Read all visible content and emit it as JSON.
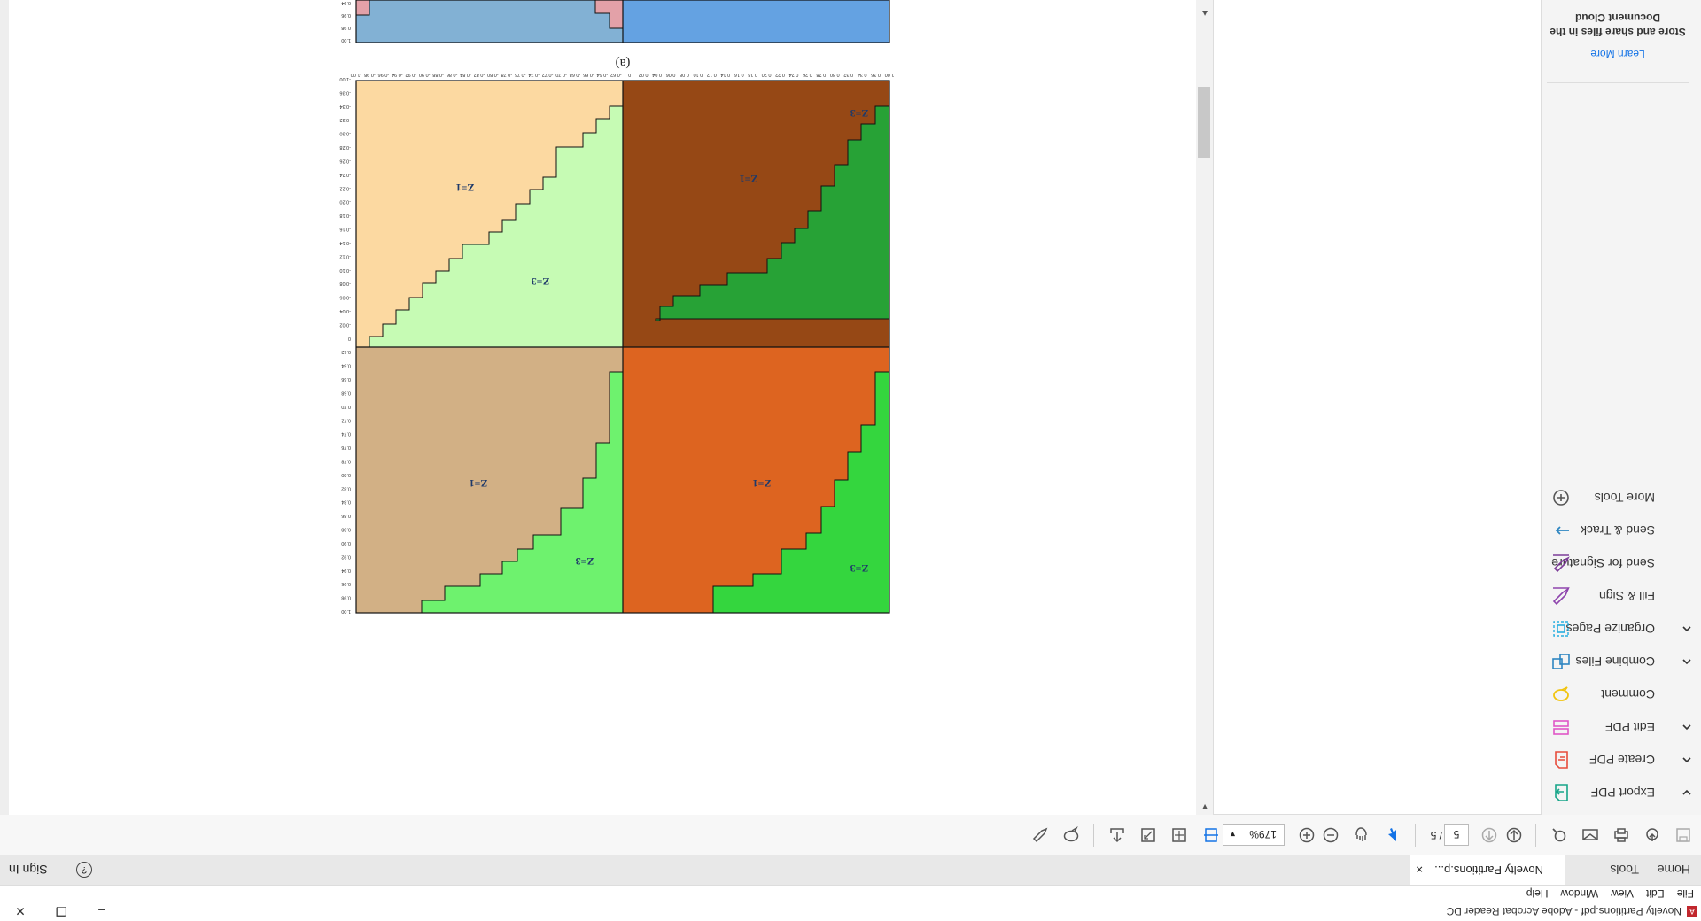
{
  "window": {
    "title": "Novelty Partitions.pdf - Adobe Acrobat Reader DC",
    "app_icon": "acrobat-icon",
    "min": "–",
    "max": "❐",
    "close": "✕"
  },
  "menu": {
    "items": [
      "File",
      "Edit",
      "View",
      "Window",
      "Help"
    ]
  },
  "tabs": {
    "home": "Home",
    "tools": "Tools",
    "document": "Novelty Partitions.p...",
    "close": "×",
    "sign_in": "Sign In",
    "help": "?"
  },
  "toolbar": {
    "page_current": "5",
    "page_total": "/ 5",
    "zoom": "179%"
  },
  "tools_panel": {
    "items": [
      {
        "label": "Export PDF",
        "icon": "export-pdf-icon",
        "color": "#17a589",
        "chevron": "down"
      },
      {
        "label": "Create PDF",
        "icon": "create-pdf-icon",
        "color": "#e74c3c",
        "chevron": "up"
      },
      {
        "label": "Edit PDF",
        "icon": "edit-pdf-icon",
        "color": "#e056c7",
        "chevron": "up"
      },
      {
        "label": "Comment",
        "icon": "comment-icon",
        "color": "#f1c40f",
        "chevron": ""
      },
      {
        "label": "Combine Files",
        "icon": "combine-files-icon",
        "color": "#2e86c1",
        "chevron": "up"
      },
      {
        "label": "Organize Pages",
        "icon": "organize-pages-icon",
        "color": "#27aee0",
        "chevron": "up"
      },
      {
        "label": "Fill & Sign",
        "icon": "fill-sign-icon",
        "color": "#8e44ad",
        "chevron": ""
      },
      {
        "label": "Send for Signature",
        "icon": "send-signature-icon",
        "color": "#7d3c98",
        "chevron": ""
      },
      {
        "label": "Send & Track",
        "icon": "send-track-icon",
        "color": "#2e86c1",
        "chevron": ""
      },
      {
        "label": "More Tools",
        "icon": "more-tools-icon",
        "color": "#555555",
        "chevron": ""
      }
    ],
    "promo_title": "Store and share files in the Document Cloud",
    "promo_link": "Learn More"
  },
  "figure": {
    "caption": "(a)",
    "x_ticks": [
      "-1.00",
      "-0.98",
      "-0.96",
      "-0.94",
      "-0.92",
      "-0.90",
      "-0.88",
      "-0.86",
      "-0.84",
      "-0.82",
      "-0.80",
      "-0.78",
      "-0.76",
      "-0.74",
      "-0.72",
      "-0.70",
      "-0.68",
      "-0.66",
      "-0.64",
      "-0.62",
      "0",
      "0.02",
      "0.04",
      "0.06",
      "0.08",
      "0.10",
      "0.12",
      "0.14",
      "0.16",
      "0.18",
      "0.20",
      "0.22",
      "0.24",
      "0.26",
      "0.28",
      "0.30",
      "0.32",
      "0.34",
      "0.36",
      "1.00"
    ],
    "y_ticks": [
      "1.00",
      "0.98",
      "0.96",
      "0.94",
      "0.92",
      "0.90",
      "0.88",
      "0.86",
      "0.84",
      "0.82",
      "0.80",
      "0.78",
      "0.76",
      "0.74",
      "0.72",
      "0.70",
      "0.68",
      "0.66",
      "0.64",
      "0.62",
      "0",
      "-0.02",
      "-0.04",
      "-0.06",
      "-0.08",
      "-0.10",
      "-0.12",
      "-0.14",
      "-0.16",
      "-0.18",
      "-0.20",
      "-0.22",
      "-0.24",
      "-0.26",
      "-0.28",
      "-0.30",
      "-0.32",
      "-0.34",
      "-0.36",
      "-1.00"
    ],
    "top_strip_ticks": [
      "1.00",
      "0.98",
      "0.96",
      "0.94"
    ],
    "quadrants": {
      "bottom_left": {
        "labels": [
          "Z=1",
          "Z=3"
        ],
        "colors": [
          "#d2b085",
          "#6ef26e"
        ]
      },
      "bottom_right": {
        "labels": [
          "Z=1",
          "Z=3"
        ],
        "colors": [
          "#dd6420",
          "#34d63e"
        ]
      },
      "top_left": {
        "labels": [
          "Z=1",
          "Z=3"
        ],
        "colors": [
          "#fcd9a1",
          "#c6fbb4"
        ]
      },
      "top_right": {
        "labels": [
          "Z=1",
          "Z=3"
        ],
        "colors": [
          "#964815",
          "#27a236"
        ]
      }
    },
    "top_strip_colors": [
      "#82b1d4",
      "#64a2e2",
      "#e3a1a8"
    ]
  }
}
